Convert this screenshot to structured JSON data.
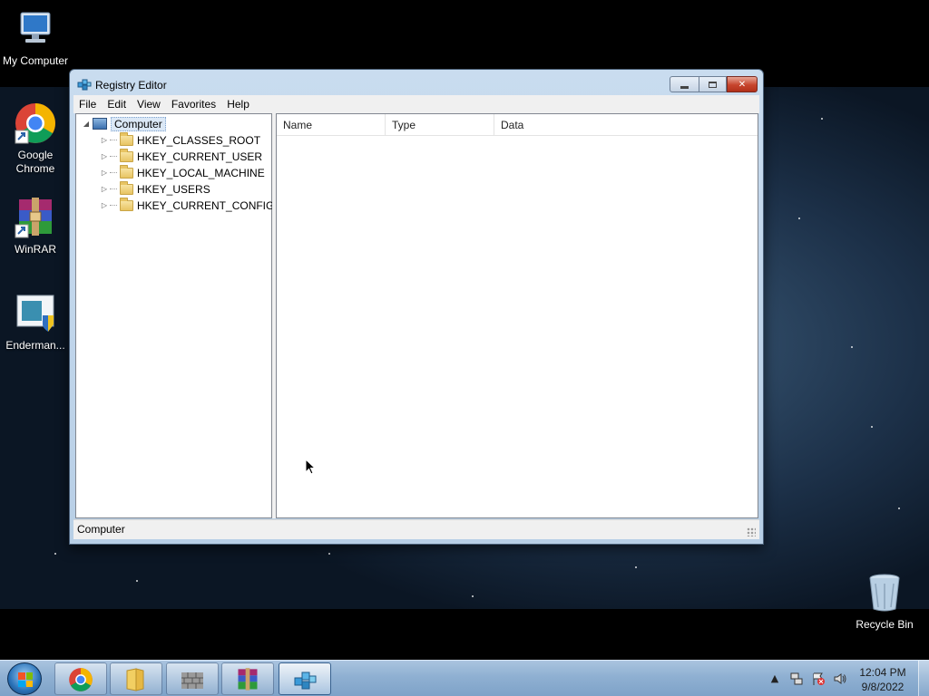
{
  "desktop": {
    "icons": [
      {
        "label": "My Computer",
        "icon": "computer-icon"
      },
      {
        "label": "Google Chrome",
        "icon": "chrome-icon"
      },
      {
        "label": "WinRAR",
        "icon": "winrar-icon"
      },
      {
        "label": "Enderman...",
        "icon": "shield-app-icon"
      },
      {
        "label": "Recycle Bin",
        "icon": "recycle-bin-icon"
      }
    ]
  },
  "window": {
    "title": "Registry Editor",
    "caption_buttons": {
      "minimize": "minimize-icon",
      "maximize": "maximize-icon",
      "close": "close-icon"
    },
    "menu": [
      "File",
      "Edit",
      "View",
      "Favorites",
      "Help"
    ],
    "tree": {
      "root": "Computer",
      "keys": [
        "HKEY_CLASSES_ROOT",
        "HKEY_CURRENT_USER",
        "HKEY_LOCAL_MACHINE",
        "HKEY_USERS",
        "HKEY_CURRENT_CONFIG"
      ]
    },
    "list_columns": [
      "Name",
      "Type",
      "Data"
    ],
    "status": "Computer"
  },
  "taskbar": {
    "pinned": [
      {
        "name": "chrome",
        "icon": "chrome-icon"
      },
      {
        "name": "explorer",
        "icon": "folder-icon"
      },
      {
        "name": "firewall",
        "icon": "wall-icon"
      },
      {
        "name": "winrar",
        "icon": "winrar-icon"
      },
      {
        "name": "regedit",
        "icon": "regedit-icon",
        "active": true
      }
    ],
    "tray_icons": [
      "show-hidden-icon",
      "network-icon",
      "action-center-icon",
      "volume-icon"
    ],
    "clock": {
      "time": "12:04 PM",
      "date": "9/8/2022"
    }
  }
}
